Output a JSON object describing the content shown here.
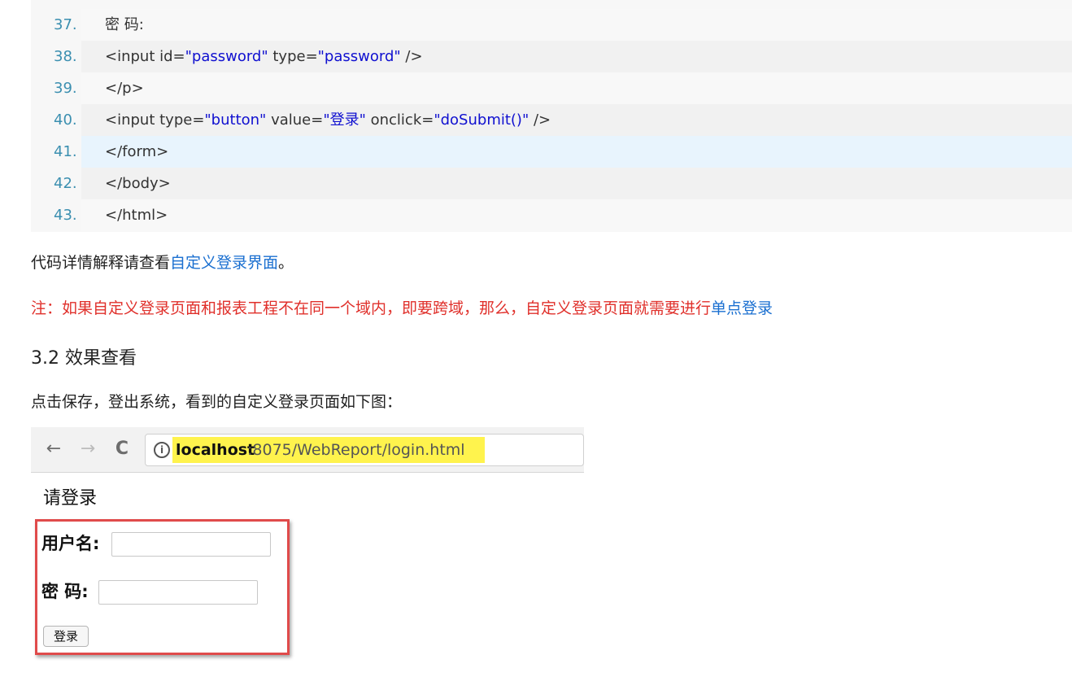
{
  "code_lines": [
    {
      "num": "37.",
      "parts": [
        {
          "t": "密 码:",
          "c": "plain"
        }
      ]
    },
    {
      "num": "38.",
      "parts": [
        {
          "t": "<input id=",
          "c": "plain"
        },
        {
          "t": "\"password\"",
          "c": "str"
        },
        {
          "t": " type=",
          "c": "plain"
        },
        {
          "t": "\"password\"",
          "c": "str"
        },
        {
          "t": " />",
          "c": "plain"
        }
      ]
    },
    {
      "num": "39.",
      "parts": [
        {
          "t": "</p>",
          "c": "plain"
        }
      ]
    },
    {
      "num": "40.",
      "parts": [
        {
          "t": "<input type=",
          "c": "plain"
        },
        {
          "t": "\"button\"",
          "c": "str"
        },
        {
          "t": " value=",
          "c": "plain"
        },
        {
          "t": "\"登录\"",
          "c": "str"
        },
        {
          "t": " onclick=",
          "c": "plain"
        },
        {
          "t": "\"doSubmit()\"",
          "c": "str"
        },
        {
          "t": " />",
          "c": "plain"
        }
      ]
    },
    {
      "num": "41.",
      "parts": [
        {
          "t": "</form>",
          "c": "plain"
        }
      ]
    },
    {
      "num": "42.",
      "parts": [
        {
          "t": "</body>",
          "c": "plain"
        }
      ]
    },
    {
      "num": "43.",
      "parts": [
        {
          "t": "</html>",
          "c": "plain"
        }
      ]
    }
  ],
  "explain": {
    "prefix": "代码详情解释请查看",
    "link": "自定义登录界面",
    "suffix": "。"
  },
  "note": {
    "text": "注：如果自定义登录页面和报表工程不在同一个域内，即要跨域，那么，自定义登录页面就需要进行",
    "link": "单点登录"
  },
  "heading": "3.2 效果查看",
  "intro": "点击保存，登出系统，看到的自定义登录页面如下图：",
  "browser": {
    "back_icon": "←",
    "forward_icon": "→",
    "reload_icon": "C",
    "info_icon": "i",
    "url_host": "localhost",
    "url_rest": ":8075/WebReport/login.html"
  },
  "login_form": {
    "title": "请登录",
    "username_label": "用户名:",
    "password_label": "密 码:",
    "submit_label": "登录"
  },
  "colors": {
    "link": "#1a6fd0",
    "note": "#e0302b",
    "code_string": "#1010d0",
    "line_number": "#3b8fb0",
    "highlight": "#fff34d",
    "red_box": "#e04b4b"
  }
}
